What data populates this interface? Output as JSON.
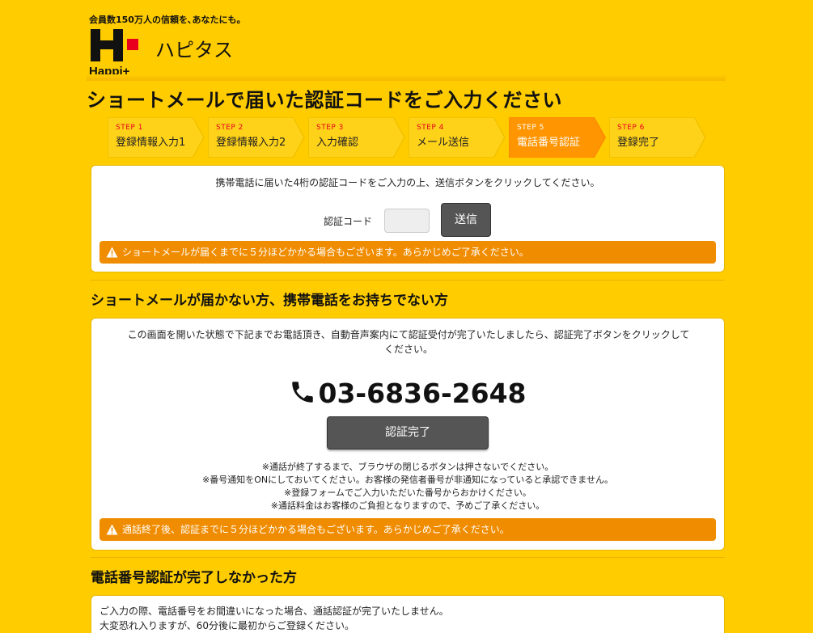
{
  "header": {
    "tagline": "会員数150万人の信頼を､あなたにも。",
    "logo_text": "Happi+",
    "site_name": "ハピタス",
    "brand_red": "#e8001c"
  },
  "page_title": "ショートメールで届いた認証コードをご入力ください",
  "steps": [
    {
      "num": "STEP 1",
      "label": "登録情報入力1",
      "active": false
    },
    {
      "num": "STEP 2",
      "label": "登録情報入力2",
      "active": false
    },
    {
      "num": "STEP 3",
      "label": "入力確認",
      "active": false
    },
    {
      "num": "STEP 4",
      "label": "メール送信",
      "active": false
    },
    {
      "num": "STEP 5",
      "label": "電話番号認証",
      "active": true
    },
    {
      "num": "STEP 6",
      "label": "登録完了",
      "active": false
    }
  ],
  "sms_card": {
    "instruction": "携帯電話に届いた4桁の認証コードをご入力の上、送信ボタンをクリックしてください。",
    "code_label": "認証コード",
    "code_value": "",
    "send_label": "送信",
    "warning": "ショートメールが届くまでに５分ほどかかる場合もございます。あらかじめご了承ください。"
  },
  "no_sms_section": {
    "title": "ショートメールが届かない方、携帯電話をお持ちでない方",
    "instruction_line1": "この画面を開いた状態で下記までお電話頂き、自動音声案内にて認証受付が完了いたしましたら、認証完了ボタンをクリックして",
    "instruction_line2": "ください。",
    "phone_number": "03-6836-2648",
    "done_label": "認証完了",
    "notes": [
      "※通話が終了するまで、ブラウザの閉じるボタンは押さないでください。",
      "※番号通知をONにしておいてください。お客様の発信者番号が非通知になっていると承認できません。",
      "※登録フォームでご入力いただいた番号からおかけください。",
      "※通話料金はお客様のご負担となりますので、予めご了承ください。"
    ],
    "warning": "通話終了後、認証までに５分ほどかかる場合もございます。あらかじめご了承ください。"
  },
  "incomplete_section": {
    "title": "電話番号認証が完了しなかった方",
    "line1": "ご入力の際、電話番号をお間違いになった場合、通話認証が完了いたしません。",
    "line2": "大変恐れ入りますが、60分後に最初からご登録ください。"
  }
}
